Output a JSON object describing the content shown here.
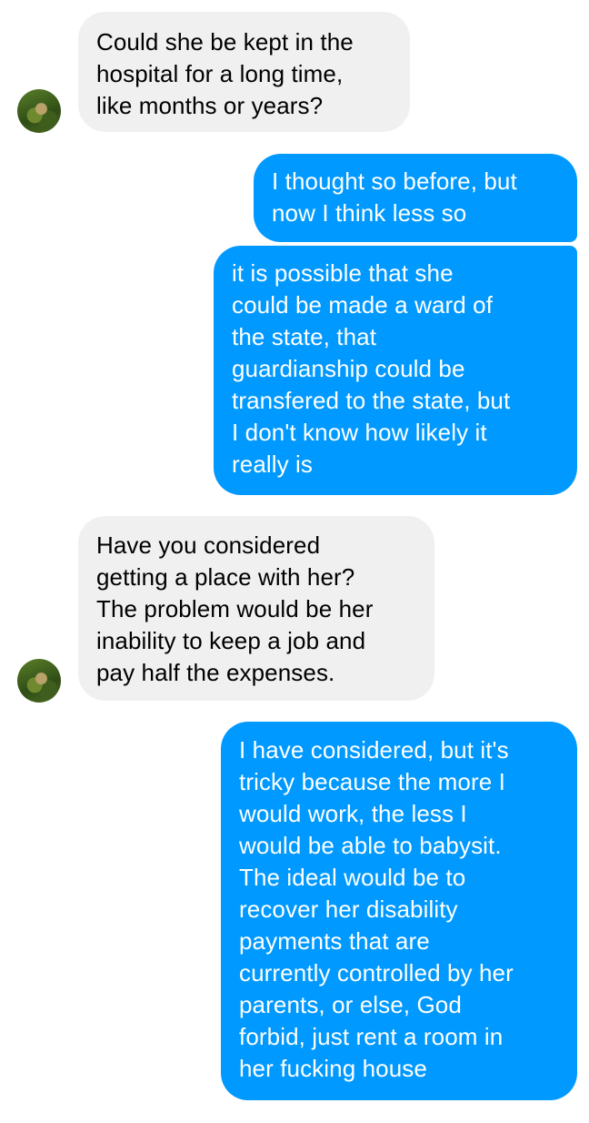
{
  "conversation": {
    "messages": [
      {
        "direction": "incoming",
        "lines": [
          "Could she be kept in the",
          "hospital for a long time,",
          "like months or years?"
        ]
      },
      {
        "direction": "outgoing",
        "lines": [
          "I thought so before, but",
          "now I think less so"
        ]
      },
      {
        "direction": "outgoing",
        "lines": [
          "it is possible that she",
          "could be made a ward of",
          "the state, that",
          "guardianship could be",
          "transfered to the state, but",
          "I don't know how likely it",
          "really is"
        ]
      },
      {
        "direction": "incoming",
        "lines": [
          "Have you considered",
          "getting a place with her?",
          "The problem would be her",
          "inability to keep a job and",
          "pay half the expenses."
        ]
      },
      {
        "direction": "outgoing",
        "lines": [
          "I have considered, but it's",
          "tricky because the more I",
          "would work, the less I",
          "would be able to babysit.",
          "The ideal would be to",
          "recover her disability",
          "payments that are",
          "currently controlled by her",
          "parents, or else, God",
          "forbid, just rent a room in",
          "her fucking house"
        ]
      }
    ]
  },
  "icons": {
    "contact_avatar": "contact-avatar-photo"
  },
  "colors": {
    "incoming_bubble": "#f1f0f0",
    "outgoing_bubble": "#0099ff",
    "incoming_text": "#000000",
    "outgoing_text": "#ffffff",
    "background": "#ffffff"
  }
}
